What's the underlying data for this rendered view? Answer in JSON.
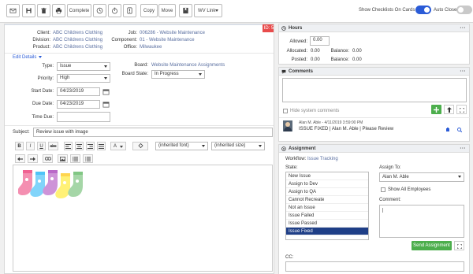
{
  "toolbar": {
    "buttons": {
      "complete": "Complete",
      "copy": "Copy",
      "move": "Move",
      "wv_link": "WV Link"
    },
    "show_checklists": "Show Checklists On Cards",
    "auto_close": "Auto Close",
    "colors": {
      "toggle_on": "#2a5bd7",
      "toggle_off": "#c9c9c9"
    }
  },
  "issue": {
    "id_badge": "ID: 5",
    "client_label": "Client:",
    "client": "ABC Childrens Clothing",
    "division_label": "Division:",
    "division": "ABC Childrens Clothing",
    "product_label": "Product:",
    "product": "ABC Childrens Clothing",
    "job_label": "Job:",
    "job": "006286 - Website Maintenance",
    "component_label": "Component:",
    "component": "01 - Website Maintenance",
    "office_label": "Office:",
    "office": "Milwaukee",
    "edit_details": "Edit Details",
    "type_label": "Type:",
    "type": "Issue",
    "priority_label": "Priority:",
    "priority": "High",
    "start_date_label": "Start Date:",
    "start_date": "04/23/2019",
    "due_date_label": "Due Date:",
    "due_date": "04/23/2019",
    "time_due_label": "Time Due:",
    "time_due": "",
    "board_label": "Board:",
    "board": "Website Maintenance Assignments",
    "board_state_label": "Board State:",
    "board_state": "In Progress",
    "subject_label": "Subject:",
    "subject": "Review issue with image"
  },
  "editor": {
    "format_buttons": [
      "B",
      "I",
      "U",
      "abc"
    ],
    "font_color": "A",
    "font_family": "(inherited font)",
    "font_size": "(inherited size)"
  },
  "hours": {
    "title": "Hours",
    "allowed_label": "Allowed:",
    "allowed": "0.00",
    "allocated_label": "Allocated:",
    "allocated": "0.00",
    "balance_label": "Balance:",
    "balance1": "0.00",
    "posted_label": "Posted:",
    "posted": "0.00",
    "balance2": "0.00"
  },
  "comments": {
    "title": "Comments",
    "hide_system": "Hide system comments",
    "entry_meta": "Alan M. Able - 4/11/2019 3:59:00 PM",
    "entry_text": "ISSUE FIXED  |  Alan M. Able  |  Please Review"
  },
  "assignment": {
    "title": "Assignment",
    "workflow_label": "Workflow:",
    "workflow": "Issue Tracking",
    "state_label": "State:",
    "states": [
      "New Issue",
      "Assign to Dev",
      "Assign to QA",
      "Cannot Recreate",
      "Not an Issue",
      "Issue Failed",
      "Issue Passed",
      "Issue Fixed"
    ],
    "assign_to_label": "Assign To:",
    "assign_to": "Alan M. Able",
    "show_all": "Show All Employees",
    "comment_label": "Comment:",
    "send_button": "Send Assignment",
    "cc_label": "CC:"
  },
  "colors": {
    "accent": "#2a5bd7",
    "selected_state": "#1f3f87",
    "green": "#4cae4c",
    "badge": "#e84c4c",
    "link": "#5a6fa0"
  }
}
